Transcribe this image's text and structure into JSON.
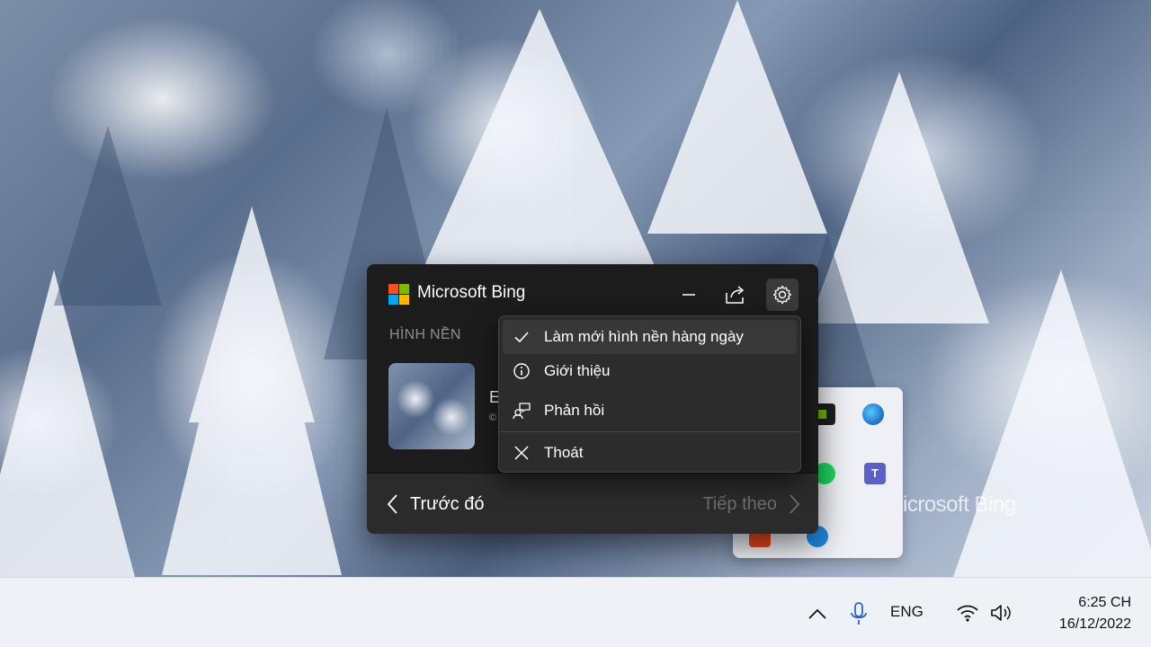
{
  "colors": {
    "popup_bg": "#1c1c1c",
    "menu_bg": "#2c2c2c",
    "footer_bg": "#2b2b2b",
    "taskbar_bg": "#eef1f6",
    "ms_logo": [
      "#f25022",
      "#7fba00",
      "#00a4ef",
      "#ffb900"
    ]
  },
  "popup": {
    "app_title": "Microsoft Bing",
    "section_label": "HÌNH NỀN",
    "thumbnail_title_fragment": "E",
    "thumbnail_sub_fragment": "©",
    "header_buttons": {
      "minimize_icon": "minimize-icon",
      "share_icon": "share-icon",
      "settings_icon": "gear-icon"
    },
    "footer": {
      "prev_label": "Trước đó",
      "next_label": "Tiếp theo"
    }
  },
  "menu": {
    "items": [
      {
        "label": "Làm mới hình nền hàng ngày",
        "icon": "checkmark-icon",
        "checked": true
      },
      {
        "label": "Giới thiệu",
        "icon": "info-icon"
      },
      {
        "label": "Phản hồi",
        "icon": "feedback-icon"
      },
      {
        "label": "Thoát",
        "icon": "close-icon"
      }
    ]
  },
  "tray_flyout": {
    "watermark_fragment": "icrosoft Bing",
    "teams_letter": "T"
  },
  "taskbar": {
    "language": "ENG",
    "time": "6:25 CH",
    "date": "16/12/2022"
  }
}
